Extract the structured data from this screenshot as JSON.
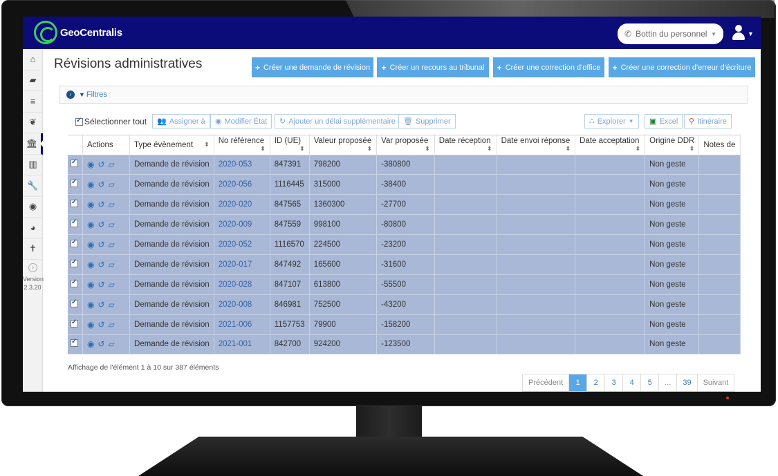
{
  "app": {
    "brand": "GeoCentralis"
  },
  "header": {
    "bottin_label": "Bottin du personnel"
  },
  "sidebar": {
    "items": [
      {
        "icon": "home-icon",
        "glyph": "⌂"
      },
      {
        "icon": "folder-open-icon",
        "glyph": "▰"
      },
      {
        "icon": "list-icon",
        "glyph": "≡"
      },
      {
        "icon": "leaf-icon",
        "glyph": "❦"
      },
      {
        "icon": "bank-icon",
        "glyph": "🏛"
      },
      {
        "icon": "building-icon",
        "glyph": "▥"
      },
      {
        "icon": "wrench-icon",
        "glyph": "🔧"
      },
      {
        "icon": "globe-icon",
        "glyph": "◉"
      },
      {
        "icon": "dashboard-icon",
        "glyph": "◕"
      },
      {
        "icon": "person-icon",
        "glyph": "✝"
      }
    ],
    "version_label": "Version",
    "version_number": "2.3.20"
  },
  "page": {
    "title": "Révisions administratives",
    "actions": [
      "Créer une demande de révision",
      "Créer un recours au tribunal",
      "Créer une correction d'office",
      "Créer une correction d'erreur d'écriture"
    ],
    "filters_label": "Filtres"
  },
  "toolbar": {
    "select_all": "Sélectionner tout",
    "assign": "Assigner à",
    "modify_state": "Modifier État",
    "add_delay": "Ajouter un délai supplémentaire",
    "delete": "Supprimer",
    "explore": "Explorer",
    "excel": "Excel",
    "itinerary": "Itinéraire"
  },
  "table": {
    "columns": [
      "",
      "Actions",
      "Type évènement",
      "No référence",
      "ID (UE)",
      "Valeur proposée",
      "Var proposée",
      "Date réception",
      "Date envoi réponse",
      "Date acceptation",
      "Origine DDR",
      "Notes de"
    ],
    "rows": [
      {
        "type": "Demande de révision",
        "ref": "2020-053",
        "id": "847391",
        "valeur": "798200",
        "var": "-380800",
        "date_rec": "",
        "date_env": "",
        "date_acc": "",
        "origine": "Non geste",
        "notes": ""
      },
      {
        "type": "Demande de révision",
        "ref": "2020-056",
        "id": "1116445",
        "valeur": "315000",
        "var": "-38400",
        "date_rec": "",
        "date_env": "",
        "date_acc": "",
        "origine": "Non geste",
        "notes": ""
      },
      {
        "type": "Demande de révision",
        "ref": "2020-020",
        "id": "847565",
        "valeur": "1360300",
        "var": "-27700",
        "date_rec": "",
        "date_env": "",
        "date_acc": "",
        "origine": "Non geste",
        "notes": ""
      },
      {
        "type": "Demande de révision",
        "ref": "2020-009",
        "id": "847559",
        "valeur": "998100",
        "var": "-80800",
        "date_rec": "",
        "date_env": "",
        "date_acc": "",
        "origine": "Non geste",
        "notes": ""
      },
      {
        "type": "Demande de révision",
        "ref": "2020-052",
        "id": "1116570",
        "valeur": "224500",
        "var": "-23200",
        "date_rec": "",
        "date_env": "",
        "date_acc": "",
        "origine": "Non geste",
        "notes": ""
      },
      {
        "type": "Demande de révision",
        "ref": "2020-017",
        "id": "847492",
        "valeur": "165600",
        "var": "-31600",
        "date_rec": "",
        "date_env": "",
        "date_acc": "",
        "origine": "Non geste",
        "notes": ""
      },
      {
        "type": "Demande de révision",
        "ref": "2020-028",
        "id": "847107",
        "valeur": "613800",
        "var": "-55500",
        "date_rec": "",
        "date_env": "",
        "date_acc": "",
        "origine": "Non geste",
        "notes": ""
      },
      {
        "type": "Demande de révision",
        "ref": "2020-008",
        "id": "846981",
        "valeur": "752500",
        "var": "-43200",
        "date_rec": "",
        "date_env": "",
        "date_acc": "",
        "origine": "Non geste",
        "notes": ""
      },
      {
        "type": "Demande de révision",
        "ref": "2021-006",
        "id": "1157753",
        "valeur": "79900",
        "var": "-158200",
        "date_rec": "",
        "date_env": "",
        "date_acc": "",
        "origine": "Non geste",
        "notes": ""
      },
      {
        "type": "Demande de révision",
        "ref": "2021-001",
        "id": "842700",
        "valeur": "924200",
        "var": "-123500",
        "date_rec": "",
        "date_env": "",
        "date_acc": "",
        "origine": "Non geste",
        "notes": ""
      }
    ]
  },
  "footer": {
    "info": "Affichage de l'élément 1 à 10 sur 387 éléments",
    "pager": [
      "Précédent",
      "1",
      "2",
      "3",
      "4",
      "5",
      "...",
      "39",
      "Suivant"
    ],
    "active_page": "1"
  }
}
